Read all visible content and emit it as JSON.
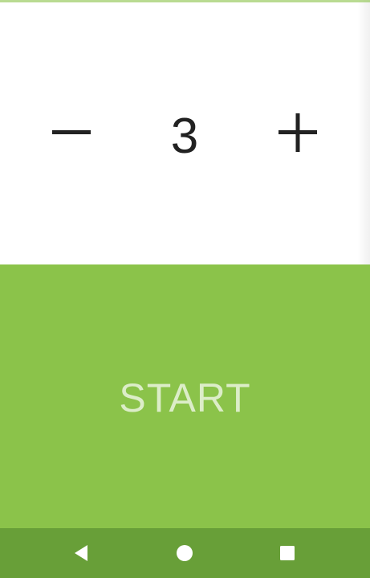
{
  "stepper": {
    "value": "3",
    "decrement_icon": "minus-icon",
    "increment_icon": "plus-icon"
  },
  "start_button": {
    "label": "START"
  },
  "nav_bar": {
    "back_icon": "back-triangle-icon",
    "home_icon": "home-circle-icon",
    "recent_icon": "recent-square-icon"
  },
  "colors": {
    "accent": "#8bc34a",
    "nav_bar": "#689f38",
    "start_text": "#dcedc8",
    "counter_text": "#222222"
  }
}
